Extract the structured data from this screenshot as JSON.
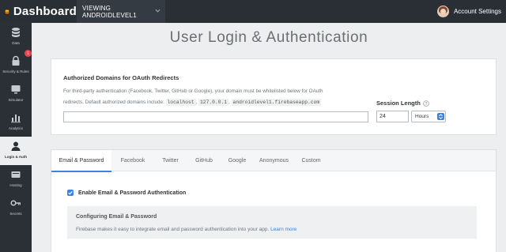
{
  "topbar": {
    "brand": "Dashboard",
    "app_selector": "VIEWING ANDROIDLEVEL1",
    "account_label": "Account Settings"
  },
  "sidebar": {
    "items": [
      {
        "label": "Data",
        "icon": "database-icon"
      },
      {
        "label": "Security & Rules",
        "icon": "lock-icon",
        "badge": "1"
      },
      {
        "label": "Simulator",
        "icon": "monitor-icon"
      },
      {
        "label": "Analytics",
        "icon": "bar-chart-icon"
      },
      {
        "label": "Login & Auth",
        "icon": "user-icon",
        "active": true
      },
      {
        "label": "Hosting",
        "icon": "hosting-icon"
      },
      {
        "label": "Secrets",
        "icon": "key-icon"
      }
    ]
  },
  "page": {
    "title": "User Login & Authentication"
  },
  "domains_card": {
    "heading": "Authorized Domains for OAuth Redirects",
    "desc_line1": "For third-party authentication (Facebook, Twitter, GitHub or Google), your domain must be whitelisted below for OAuth",
    "desc_line2_prefix": "redirects. Default authorized domains include:",
    "default_domains": [
      "localhost",
      "127.0.0.1",
      "androidlevel1.firebaseapp.com"
    ],
    "domains_value": "",
    "session_length_label": "Session Length",
    "session_length_value": "24",
    "session_unit": "Hours"
  },
  "auth_card": {
    "tabs": [
      "Email & Password",
      "Facebook",
      "Twitter",
      "GitHub",
      "Google",
      "Anonymous",
      "Custom"
    ],
    "active_tab": "Email & Password",
    "enable_label": "Enable Email & Password Authentication",
    "enable_checked": true,
    "info_title": "Configuring Email & Password",
    "info_text": "Firebase makes it easy to integrate email and password authentication into your app.",
    "learn_more": "Learn more"
  },
  "colors": {
    "accent": "#3b82e6",
    "topbar": "#2a2f35",
    "badge": "#e8434f"
  }
}
